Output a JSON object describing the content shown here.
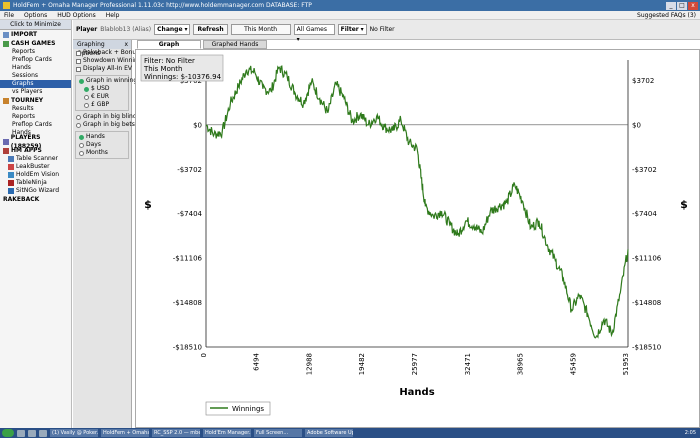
{
  "titlebar": {
    "title": "HoldFem + Omaha Manager Professional 1.11.03c        http://www.holdemmanager.com      DATABASE: FTP"
  },
  "menu": {
    "items": [
      "File",
      "Options",
      "HUD Options",
      "Help"
    ],
    "right": "Suggested FAQs (3)"
  },
  "sidebar": {
    "minimize_label": "Click to Minimize",
    "sections": [
      {
        "title": "IMPORT",
        "items": []
      },
      {
        "title": "CASH GAMES",
        "items": [
          "Reports",
          "Preflop Cards",
          "Hands",
          "Sessions",
          "Graphs",
          "vs Players"
        ],
        "selected": 4
      },
      {
        "title": "TOURNEY",
        "items": [
          "Results",
          "Reports",
          "Preflop Cards",
          "Hands"
        ]
      },
      {
        "title": "PLAYERS (188259)",
        "items": []
      },
      {
        "title": "HM APPS",
        "items": []
      }
    ],
    "apps": [
      "Table Scanner",
      "LeakBuster",
      "HoldEm Vision",
      "TableNinja",
      "SitNGo Wizard"
    ],
    "rakeback": "RAKEBACK"
  },
  "toolbar": {
    "player_label": "Player",
    "player_value": "Blablob13 (Alias)",
    "change_label": "Change",
    "refresh_label": "Refresh",
    "period_label": "This Month",
    "games_value": "All Games",
    "filter_label": "Filter",
    "filter_text": "No Filter"
  },
  "graph_options": {
    "title": "Graphing Options",
    "checks": [
      "Rakeback + Bonuses",
      "Showdown Winnings",
      "Display All-In EV"
    ],
    "units": {
      "title": "Graph in winnings",
      "options": [
        "$ USD",
        "€ EUR",
        "£ GBP"
      ],
      "selected": 0
    },
    "other": [
      "Graph in big blinds",
      "Graph in big bets"
    ],
    "xaxis": [
      "Hands",
      "Days",
      "Months"
    ],
    "xaxis_selected": 0
  },
  "tabs": [
    "Graph",
    "Graphed Hands"
  ],
  "info_box": {
    "line1": "Filter: No Filter",
    "line2": "This Month",
    "line3": "Winnings: $-10376.94"
  },
  "chart_data": {
    "type": "line",
    "xlabel": "Hands",
    "ylabel": "$",
    "x_ticks": [
      "0",
      "6494",
      "12988",
      "19482",
      "25977",
      "32471",
      "38965",
      "45459",
      "51953"
    ],
    "y_ticks": [
      "$3702",
      "$0",
      "-$3702",
      "-$7404",
      "-$11106",
      "-$14808",
      "-$18510"
    ],
    "xlim": [
      0,
      51953
    ],
    "ylim": [
      -18510,
      5400
    ],
    "series": [
      {
        "name": "Winnings",
        "color": "#2f7a1c",
        "x": [
          0,
          1000,
          2000,
          3000,
          4000,
          5000,
          6000,
          7000,
          8000,
          9000,
          10000,
          11000,
          12000,
          13000,
          14000,
          15000,
          16000,
          17000,
          18000,
          19000,
          20000,
          21000,
          22000,
          23000,
          24000,
          25000,
          26000,
          26500,
          27000,
          28000,
          29000,
          30000,
          31000,
          32000,
          33000,
          34000,
          35000,
          36000,
          37000,
          38000,
          39000,
          40000,
          41000,
          42000,
          43000,
          44000,
          45000,
          46000,
          47000,
          48000,
          49000,
          50000,
          51000,
          51953
        ],
        "values": [
          0,
          -800,
          -600,
          1800,
          3200,
          4600,
          4400,
          3000,
          2800,
          4800,
          4000,
          2600,
          1800,
          3600,
          2200,
          1000,
          3400,
          2200,
          300,
          900,
          0,
          700,
          -200,
          -500,
          400,
          -1500,
          -2000,
          -4500,
          -6800,
          -7600,
          -7200,
          -8300,
          -9200,
          -8000,
          -8400,
          -9000,
          -7200,
          -6800,
          -6500,
          -5000,
          -6400,
          -8600,
          -8000,
          -10000,
          -11300,
          -12800,
          -15400,
          -14200,
          -15800,
          -17700,
          -16200,
          -17400,
          -14000,
          -10377
        ]
      }
    ],
    "legend": {
      "position": "bottom-left",
      "label": "Winnings"
    },
    "grid": false
  },
  "taskbar": {
    "tasks": [
      "(1) Vasily @ Poker...",
      "HoldFem + Omaha Man...",
      "RC_SSP 2.0 — mbex...",
      "Hold'Em Manager...",
      "Full Screen...",
      "Adobe Software Update"
    ],
    "clock": "2:05"
  },
  "colors": {
    "accent": "#2d5fa8",
    "line": "#2f7a1c"
  }
}
